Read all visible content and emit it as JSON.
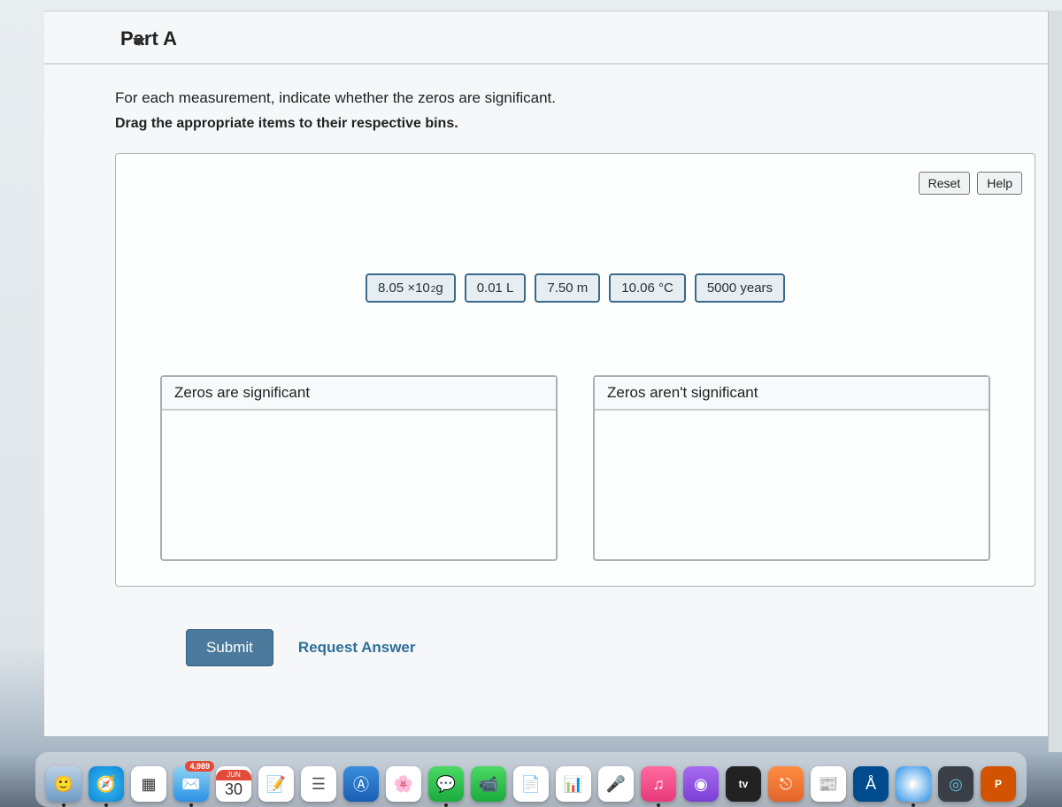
{
  "part": {
    "title": "Part A"
  },
  "question": {
    "prompt": "For each measurement, indicate whether the zeros are significant.",
    "instruction": "Drag the appropriate items to their respective bins."
  },
  "toolbar": {
    "reset": "Reset",
    "help": "Help"
  },
  "items": {
    "i0": {
      "base": "8.05 ×10",
      "sup": "2",
      "unit": "g"
    },
    "i1": "0.01 L",
    "i2": "7.50 m",
    "i3": "10.06 °C",
    "i4": "5000 years"
  },
  "bins": {
    "sig": "Zeros are significant",
    "notsig": "Zeros aren't significant"
  },
  "actions": {
    "submit": "Submit",
    "request": "Request Answer"
  },
  "dock": {
    "mail_badge": "4,989",
    "cal_month": "JUN",
    "cal_day": "30",
    "tv": "tv",
    "p": "P"
  }
}
